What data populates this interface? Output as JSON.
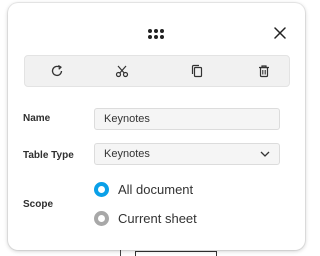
{
  "panel": {
    "toolbar": {
      "icons": [
        "refresh-icon",
        "scissors-icon",
        "copy-icon",
        "trash-icon"
      ]
    },
    "fields": {
      "name_label": "Name",
      "name_value": "Keynotes",
      "table_type_label": "Table Type",
      "table_type_value": "Keynotes",
      "scope_label": "Scope",
      "scope_options": [
        "All document",
        "Current sheet"
      ],
      "scope_selected": "All document"
    }
  },
  "colors": {
    "accent": "#0aa0e8",
    "radio_off": "#a8a8a8",
    "toolbar_bg": "#f1f1f1"
  }
}
